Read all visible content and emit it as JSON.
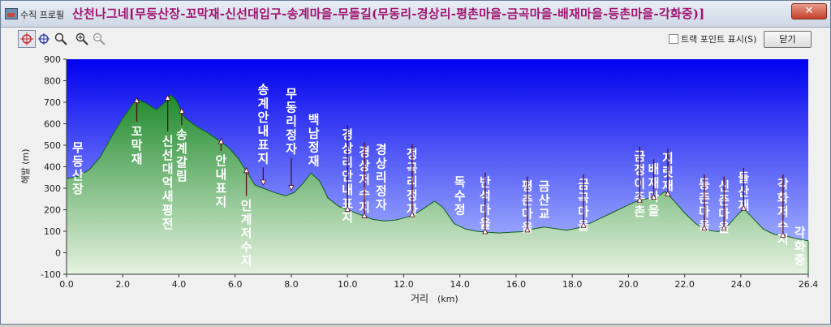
{
  "window": {
    "app_title": "수직 프로필",
    "route_title": "산천나그네[무등산장-꼬막재-신선대입구-송계마을-무돌길(무동리-경상리-평촌마을-금곡마을-배재마을-등촌마을-각화중)]",
    "close_glyph": "✕"
  },
  "toolbar": {
    "icons": [
      "target-icon",
      "crosshair-icon",
      "magnifier-icon",
      "zoom-in-icon",
      "zoom-out-icon"
    ],
    "track_point_label": "트랙 포인트 표시(S)",
    "track_point_checked": false,
    "close_button_label": "닫기"
  },
  "colors": {
    "sky_top": "#0000ee",
    "sky_bottom": "#b9c9ff",
    "terrain_top": "#1e8a2c",
    "terrain_bottom": "#e6f2e0",
    "title": "#a0146e",
    "annotation": "#ffffff"
  },
  "chart_data": {
    "type": "area",
    "xlabel": "거리",
    "xlabel_unit": "(km)",
    "ylabel": "해발 (m)",
    "xlim": [
      0,
      26.4
    ],
    "ylim": [
      -100,
      900
    ],
    "x_ticks": [
      "0.0",
      "2.0",
      "4.0",
      "6.0",
      "8.0",
      "10.0",
      "12.0",
      "14.0",
      "16.0",
      "18.0",
      "20.0",
      "22.0",
      "24.0",
      "26.4"
    ],
    "y_ticks": [
      "-100",
      "0",
      "100",
      "200",
      "300",
      "400",
      "500",
      "600",
      "700",
      "800",
      "900"
    ],
    "grid": false,
    "profile": [
      [
        0,
        345
      ],
      [
        0.4,
        355
      ],
      [
        0.8,
        385
      ],
      [
        1.2,
        445
      ],
      [
        1.6,
        540
      ],
      [
        2.0,
        625
      ],
      [
        2.4,
        700
      ],
      [
        2.6,
        710
      ],
      [
        2.9,
        690
      ],
      [
        3.2,
        665
      ],
      [
        3.5,
        700
      ],
      [
        3.7,
        735
      ],
      [
        3.9,
        710
      ],
      [
        4.2,
        630
      ],
      [
        4.6,
        590
      ],
      [
        5.0,
        560
      ],
      [
        5.4,
        525
      ],
      [
        5.8,
        485
      ],
      [
        6.1,
        440
      ],
      [
        6.4,
        380
      ],
      [
        6.7,
        315
      ],
      [
        7.0,
        300
      ],
      [
        7.4,
        280
      ],
      [
        7.8,
        265
      ],
      [
        8.1,
        280
      ],
      [
        8.4,
        320
      ],
      [
        8.7,
        370
      ],
      [
        9.0,
        335
      ],
      [
        9.3,
        255
      ],
      [
        9.7,
        215
      ],
      [
        10.1,
        195
      ],
      [
        10.5,
        175
      ],
      [
        10.9,
        155
      ],
      [
        11.3,
        148
      ],
      [
        11.7,
        152
      ],
      [
        12.1,
        165
      ],
      [
        12.4,
        180
      ],
      [
        12.7,
        205
      ],
      [
        13.1,
        240
      ],
      [
        13.4,
        210
      ],
      [
        13.8,
        135
      ],
      [
        14.2,
        110
      ],
      [
        14.6,
        100
      ],
      [
        15.0,
        95
      ],
      [
        15.4,
        92
      ],
      [
        15.8,
        95
      ],
      [
        16.2,
        98
      ],
      [
        16.6,
        110
      ],
      [
        17.0,
        120
      ],
      [
        17.4,
        112
      ],
      [
        17.8,
        105
      ],
      [
        18.2,
        115
      ],
      [
        18.6,
        135
      ],
      [
        19.0,
        160
      ],
      [
        19.4,
        185
      ],
      [
        19.8,
        210
      ],
      [
        20.2,
        235
      ],
      [
        20.6,
        250
      ],
      [
        21.0,
        258
      ],
      [
        21.3,
        285
      ],
      [
        21.6,
        245
      ],
      [
        22.0,
        185
      ],
      [
        22.4,
        135
      ],
      [
        22.8,
        105
      ],
      [
        23.2,
        98
      ],
      [
        23.5,
        120
      ],
      [
        23.8,
        165
      ],
      [
        24.1,
        205
      ],
      [
        24.4,
        165
      ],
      [
        24.8,
        110
      ],
      [
        25.2,
        85
      ],
      [
        25.6,
        78
      ],
      [
        26.0,
        65
      ],
      [
        26.4,
        55
      ]
    ],
    "annotations": [
      {
        "label": "무등산장",
        "x": 0.4,
        "y": 470,
        "arrow": false
      },
      {
        "label": "꼬막재",
        "x": 2.5,
        "y": 545,
        "arrow": true
      },
      {
        "label": "신선대억새평전",
        "x": 3.6,
        "y": 500,
        "arrow": true
      },
      {
        "label": "송계갈림",
        "x": 4.1,
        "y": 530,
        "arrow": true
      },
      {
        "label": "안내표지",
        "x": 5.5,
        "y": 410,
        "arrow": true
      },
      {
        "label": "인계저수지",
        "x": 6.4,
        "y": 200,
        "arrow": true
      },
      {
        "label": "송계안내표지",
        "x": 7.0,
        "y": 740,
        "arrow": true
      },
      {
        "label": "무동리정자",
        "x": 8.0,
        "y": 720,
        "arrow": true
      },
      {
        "label": "백남정재",
        "x": 8.8,
        "y": 600,
        "arrow": true
      },
      {
        "label": "경상리안내표지",
        "x": 10.0,
        "y": 530,
        "arrow": true
      },
      {
        "label": "경상저수지",
        "x": 10.6,
        "y": 450,
        "arrow": true
      },
      {
        "label": "경상리정자",
        "x": 11.2,
        "y": 460,
        "arrow": true
      },
      {
        "label": "정곡리정자",
        "x": 12.3,
        "y": 440,
        "arrow": true
      },
      {
        "label": "독수정",
        "x": 14.0,
        "y": 310,
        "arrow": true
      },
      {
        "label": "반석마을",
        "x": 14.9,
        "y": 310,
        "arrow": true
      },
      {
        "label": "평촌마을",
        "x": 16.4,
        "y": 290,
        "arrow": true
      },
      {
        "label": "금산교",
        "x": 17.0,
        "y": 290,
        "arrow": true
      },
      {
        "label": "금곡마을",
        "x": 18.4,
        "y": 300,
        "arrow": true
      },
      {
        "label": "금정이주촌",
        "x": 20.4,
        "y": 430,
        "arrow": true
      },
      {
        "label": "배재마을",
        "x": 20.9,
        "y": 370,
        "arrow": true
      },
      {
        "label": "지릿재",
        "x": 21.4,
        "y": 420,
        "arrow": true
      },
      {
        "label": "등촌마을",
        "x": 22.7,
        "y": 300,
        "arrow": true
      },
      {
        "label": "신촌마을",
        "x": 23.4,
        "y": 290,
        "arrow": true
      },
      {
        "label": "들산재",
        "x": 24.1,
        "y": 330,
        "arrow": true
      },
      {
        "label": "각화저수지",
        "x": 25.5,
        "y": 300,
        "arrow": true
      },
      {
        "label": "각화중",
        "x": 26.1,
        "y": 75,
        "arrow": false
      }
    ]
  }
}
